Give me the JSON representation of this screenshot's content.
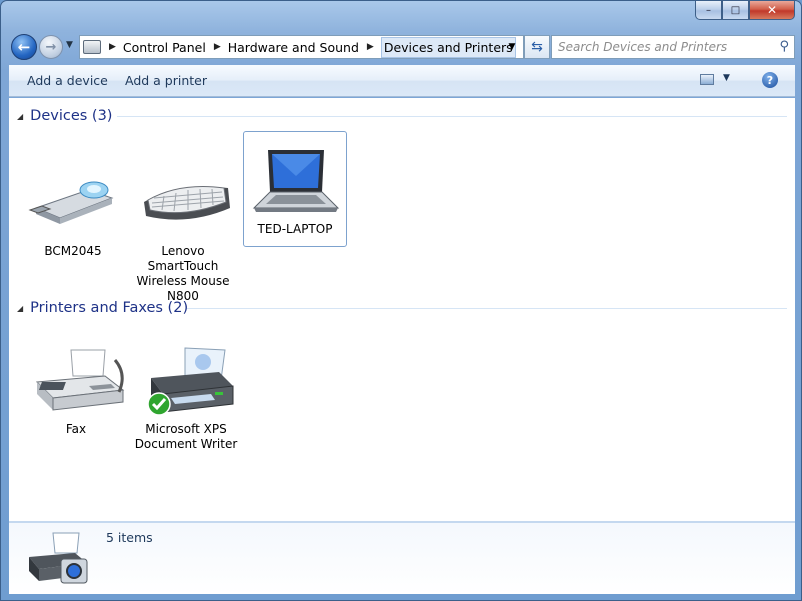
{
  "address": {
    "crumbs": [
      "Control Panel",
      "Hardware and Sound",
      "Devices and Printers"
    ]
  },
  "search": {
    "placeholder": "Search Devices and Printers"
  },
  "commands": {
    "add_device": "Add a device",
    "add_printer": "Add a printer"
  },
  "groups": [
    {
      "title": "Devices (3)",
      "items": [
        {
          "label": "BCM2045",
          "icon": "usb-dongle-icon"
        },
        {
          "label": "Lenovo SmartTouch Wireless Mouse N800",
          "icon": "keyboard-icon"
        },
        {
          "label": "TED-LAPTOP",
          "icon": "laptop-icon",
          "selected": true
        }
      ]
    },
    {
      "title": "Printers and Faxes (2)",
      "items": [
        {
          "label": "Fax",
          "icon": "fax-icon"
        },
        {
          "label": "Microsoft XPS Document Writer",
          "icon": "printer-icon",
          "default": true
        }
      ]
    }
  ],
  "details": {
    "count": "5 items",
    "icon": "devices-printers-icon"
  },
  "colors": {
    "group_title": "#1e3287",
    "command_text": "#1e395b",
    "selection_border": "#7da2ce"
  }
}
